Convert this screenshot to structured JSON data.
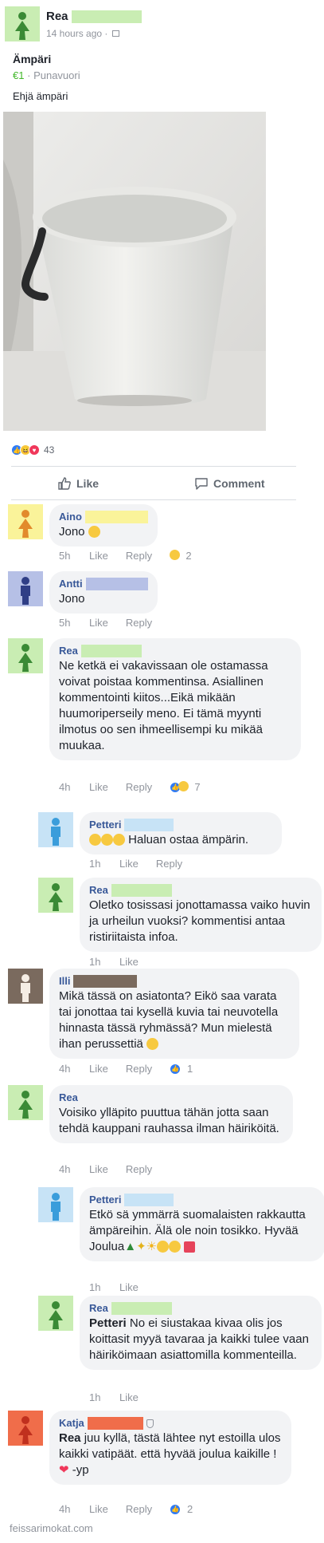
{
  "colors": {
    "female_avatar_bg": "#c9edb3",
    "female_avatar_figure": "#3a8a35",
    "yellow_avatar_bg": "#faf39a",
    "yellow_avatar_figure": "#e28a2c",
    "blue_avatar_bg": "#b6c0e6",
    "blue_avatar_figure": "#2f3e86",
    "lightblue_avatar_bg": "#c7e3f6",
    "lightblue_avatar_figure": "#3a9ddb",
    "brown_avatar_bg": "#7a6a5e",
    "brown_avatar_figure": "#f5ede4",
    "red_avatar_bg": "#f06d4a",
    "red_avatar_figure": "#c0301e",
    "censor_green": "#c9edb3",
    "censor_yellow": "#faf39a",
    "censor_blue": "#b6c0e6",
    "censor_lightblue": "#c7e3f6",
    "censor_brown": "#7a6a5e",
    "censor_orange": "#f06d4a",
    "accent_blue": "#2e7bf6",
    "price_green": "#42b72a"
  },
  "post": {
    "author": "Rea",
    "time": "14 hours ago",
    "separator": "·",
    "title": "Ämpäri",
    "price": "€1",
    "location": "Punavuori",
    "description": "Ehjä ämpäri",
    "reaction_count": "43",
    "like_label": "Like",
    "comment_label": "Comment"
  },
  "comments": [
    {
      "author": "Aino",
      "text": "Jono",
      "time": "5h",
      "like": "Like",
      "reply": "Reply",
      "reactions": "2"
    },
    {
      "author": "Antti",
      "text": "Jono",
      "time": "5h",
      "like": "Like",
      "reply": "Reply"
    },
    {
      "author": "Rea",
      "text": "Ne ketkä ei vakavissaan ole ostamassa voivat poistaa kommentinsa. Asiallinen kommentointi kiitos...Eikä mikään huumoriperseily meno. Ei tämä myynti ilmotus oo sen ihmeellisempi ku mikää muukaa.",
      "time": "4h",
      "like": "Like",
      "reply": "Reply",
      "reactions": "7"
    },
    {
      "author": "Petteri",
      "text": "Haluan ostaa ämpärin.",
      "time": "1h",
      "like": "Like",
      "reply": "Reply"
    },
    {
      "author": "Rea",
      "text": "Oletko tosissasi jonottamassa vaiko huvin ja urheilun vuoksi?  kommentisi antaa ristiriitaista infoa.",
      "time": "1h",
      "like": "Like"
    },
    {
      "author": "Illi",
      "text": "Mikä tässä on asiatonta? Eikö saa varata tai jonottaa tai kysellä kuvia tai neuvotella hinnasta tässä ryhmässä? Mun mielestä ihan perussettiä",
      "time": "4h",
      "like": "Like",
      "reply": "Reply",
      "reactions": "1"
    },
    {
      "author": "Rea",
      "text": "Voisiko ylläpito puuttua tähän jotta saan tehdä kauppani rauhassa ilman häiriköitä.",
      "time": "4h",
      "like": "Like",
      "reply": "Reply"
    },
    {
      "author": "Petteri",
      "text": "Etkö sä ymmärrä suomalaisten rakkautta ämpäreihin. Älä ole noin tosikko. Hyvää Joulua",
      "time": "1h",
      "like": "Like"
    },
    {
      "author": "Rea",
      "mention": "Petteri",
      "text": "No ei siustakaa kivaa olis jos koittasit myyä tavaraa ja kaikki tulee vaan häiriköimaan asiattomilla kommenteilla.",
      "time": "1h",
      "like": "Like"
    },
    {
      "author": "Katja",
      "mention": "Rea",
      "text": "juu kyllä, tästä lähtee nyt estoilla ulos kaikki vatipäät.  että hyvää joulua kaikille !",
      "text_end": "-yp",
      "time": "4h",
      "like": "Like",
      "reply": "Reply",
      "reactions": "2"
    }
  ],
  "watermark": "feissarimokat.com"
}
